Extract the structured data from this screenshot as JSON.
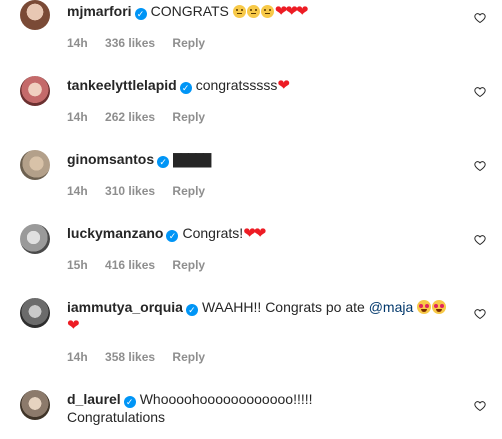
{
  "comments": [
    {
      "username": "mjmarfori",
      "text": "CONGRATS",
      "emoji": "blank-face-x3 red-heart-x3",
      "time": "14h",
      "likes": "336 likes",
      "reply": "Reply",
      "avatar_color": "#b07a63"
    },
    {
      "username": "tankeelyttlelapid",
      "text": "congratsssss",
      "emoji": "red-heart",
      "time": "14h",
      "likes": "262 likes",
      "reply": "Reply",
      "avatar_color": "#c46a6a"
    },
    {
      "username": "ginomsantos",
      "text": "▇▇▇▇▇",
      "time": "14h",
      "likes": "310 likes",
      "reply": "Reply",
      "avatar_color": "#8b7b6a"
    },
    {
      "username": "luckymanzano",
      "text": "Congrats!",
      "emoji": "red-heart-x2",
      "time": "15h",
      "likes": "416 likes",
      "reply": "Reply",
      "avatar_color": "#9a9a9a"
    },
    {
      "username": "iammutya_orquia",
      "text": "WAAHH!! Congrats po ate",
      "mention": "@maja",
      "emoji": "heart-eyes-x2 red-heart",
      "time": "14h",
      "likes": "358 likes",
      "reply": "Reply",
      "avatar_color": "#6b6b6b"
    },
    {
      "username": "d_laurel",
      "text": "Whoooohoooooooooooo!!!!!",
      "text2": "Congratulations",
      "avatar_color": "#8c7a6b"
    }
  ],
  "colors": {
    "verified": "#0095f6",
    "heart": "#ed1c24",
    "meta": "#8e8e8e",
    "mention": "#00376b"
  },
  "icons": {
    "verified": "verified-badge-icon",
    "like": "heart-outline-icon"
  }
}
